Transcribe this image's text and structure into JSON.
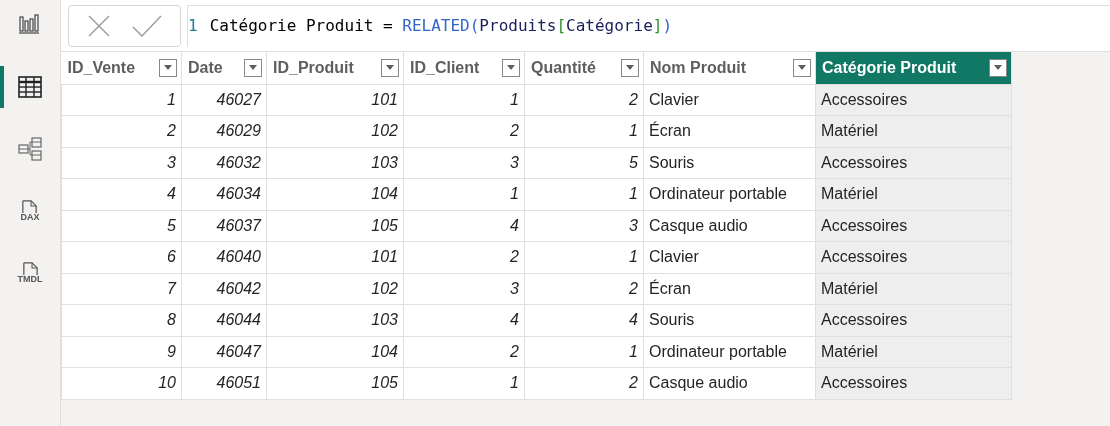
{
  "sidebar": {
    "items": [
      {
        "kind": "report",
        "selected": false
      },
      {
        "kind": "table",
        "selected": true
      },
      {
        "kind": "model",
        "selected": false
      },
      {
        "kind": "dax",
        "label": "DAX",
        "selected": false
      },
      {
        "kind": "tmdl",
        "label": "TMDL",
        "selected": false
      }
    ]
  },
  "formula_bar": {
    "line_number": "1",
    "tokens": [
      {
        "kind": "plain",
        "text": "Catégorie Produit = "
      },
      {
        "kind": "function",
        "text": "RELATED("
      },
      {
        "kind": "table",
        "text": "Produits"
      },
      {
        "kind": "bracket",
        "text": "["
      },
      {
        "kind": "table",
        "text": "Catégorie"
      },
      {
        "kind": "bracket",
        "text": "]"
      },
      {
        "kind": "function",
        "text": ")"
      }
    ]
  },
  "table": {
    "columns": [
      {
        "name": "ID_Vente",
        "kind": "number",
        "selected": false
      },
      {
        "name": "Date",
        "kind": "number",
        "selected": false
      },
      {
        "name": "ID_Produit",
        "kind": "number",
        "selected": false
      },
      {
        "name": "ID_Client",
        "kind": "number",
        "selected": false
      },
      {
        "name": "Quantité",
        "kind": "number",
        "selected": false
      },
      {
        "name": "Nom Produit",
        "kind": "text",
        "selected": false
      },
      {
        "name": "Catégorie Produit",
        "kind": "text",
        "selected": true
      }
    ],
    "rows": [
      [
        "1",
        "46027",
        "101",
        "1",
        "2",
        "Clavier",
        "Accessoires"
      ],
      [
        "2",
        "46029",
        "102",
        "2",
        "1",
        "Écran",
        "Matériel"
      ],
      [
        "3",
        "46032",
        "103",
        "3",
        "5",
        "Souris",
        "Accessoires"
      ],
      [
        "4",
        "46034",
        "104",
        "1",
        "1",
        "Ordinateur portable",
        "Matériel"
      ],
      [
        "5",
        "46037",
        "105",
        "4",
        "3",
        "Casque audio",
        "Accessoires"
      ],
      [
        "6",
        "46040",
        "101",
        "2",
        "1",
        "Clavier",
        "Accessoires"
      ],
      [
        "7",
        "46042",
        "102",
        "3",
        "2",
        "Écran",
        "Matériel"
      ],
      [
        "8",
        "46044",
        "103",
        "4",
        "4",
        "Souris",
        "Accessoires"
      ],
      [
        "9",
        "46047",
        "104",
        "2",
        "1",
        "Ordinateur portable",
        "Matériel"
      ],
      [
        "10",
        "46051",
        "105",
        "1",
        "2",
        "Casque audio",
        "Accessoires"
      ]
    ]
  }
}
